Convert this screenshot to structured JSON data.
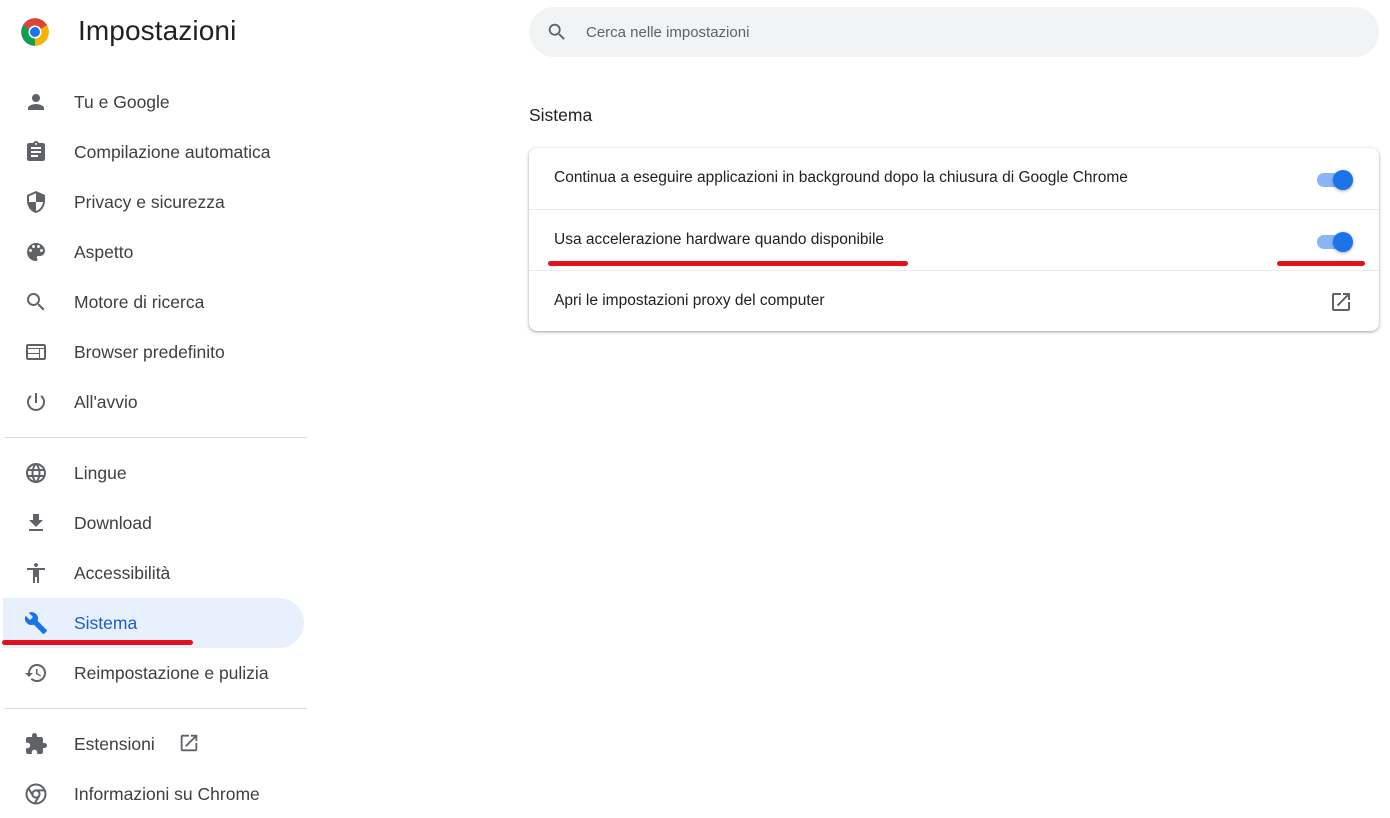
{
  "header": {
    "title": "Impostazioni",
    "logo_icon": "chrome-logo-icon"
  },
  "search": {
    "placeholder": "Cerca nelle impostazioni",
    "value": "",
    "icon": "search-icon"
  },
  "sidebar": {
    "group1": [
      {
        "label": "Tu e Google",
        "icon": "person-icon"
      },
      {
        "label": "Compilazione automatica",
        "icon": "clipboard-icon"
      },
      {
        "label": "Privacy e sicurezza",
        "icon": "shield-icon"
      },
      {
        "label": "Aspetto",
        "icon": "palette-icon"
      },
      {
        "label": "Motore di ricerca",
        "icon": "search-icon"
      },
      {
        "label": "Browser predefinito",
        "icon": "browser-window-icon"
      },
      {
        "label": "All'avvio",
        "icon": "power-icon"
      }
    ],
    "group2": [
      {
        "label": "Lingue",
        "icon": "globe-icon"
      },
      {
        "label": "Download",
        "icon": "download-icon"
      },
      {
        "label": "Accessibilità",
        "icon": "accessibility-icon"
      },
      {
        "label": "Sistema",
        "icon": "wrench-icon",
        "active": true
      },
      {
        "label": "Reimpostazione e pulizia",
        "icon": "history-icon"
      }
    ],
    "group3": [
      {
        "label": "Estensioni",
        "icon": "puzzle-icon",
        "external": true
      },
      {
        "label": "Informazioni su Chrome",
        "icon": "chrome-outline-icon"
      }
    ]
  },
  "main": {
    "section_title": "Sistema",
    "rows": [
      {
        "label": "Continua a eseguire applicazioni in background dopo la chiusura di Google Chrome",
        "control": "toggle",
        "checked": true
      },
      {
        "label": "Usa accelerazione hardware quando disponibile",
        "control": "toggle",
        "checked": true
      },
      {
        "label": "Apri le impostazioni proxy del computer",
        "control": "open-in-new",
        "icon": "open-in-new-icon"
      }
    ]
  },
  "colors": {
    "accent": "#1a73e8",
    "accent_track": "#8ab4f8",
    "active_bg": "#e8f0fe",
    "active_text": "#1a5dc9",
    "annotation": "#e0121c",
    "icon": "#5f6368"
  }
}
